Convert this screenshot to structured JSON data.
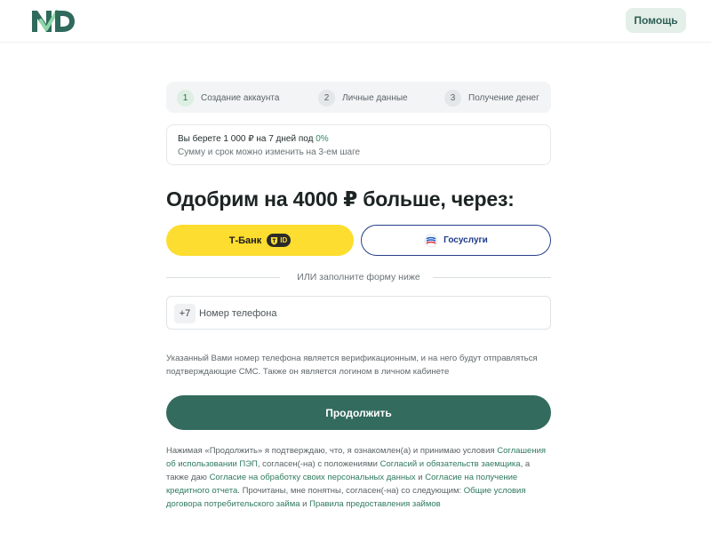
{
  "header": {
    "logo_text": "ND",
    "help_label": "Помощь",
    "brand_color": "#2f6a5c"
  },
  "steps": [
    {
      "num": "1",
      "label": "Создание аккаунта",
      "active": true
    },
    {
      "num": "2",
      "label": "Личные данные",
      "active": false
    },
    {
      "num": "3",
      "label": "Получение денег",
      "active": false
    }
  ],
  "loan_info": {
    "line1_prefix": "Вы берете 1 000 ₽ на 7 дней под ",
    "rate": "0%",
    "line2": "Сумму и срок можно изменить на 3-ем шаге"
  },
  "main": {
    "title": "Одобрим на 4000 ₽ больше, через:",
    "tbank_label": "Т-Банк",
    "tbank_badge": "ID",
    "gosuslugi_label": "Госуслуги",
    "or_text": "ИЛИ заполните форму ниже"
  },
  "phone": {
    "prefix": "+7",
    "placeholder": "Номер телефона",
    "value": "",
    "note": "Указанный Вами номер телефона является верификационным, и на него будут отправляться подтверждающие СМС. Также он является логином в личном кабинете"
  },
  "continue_label": "Продолжить",
  "consent": {
    "part1": "Нажимая «Продолжить» я подтверждаю, что, я ознакомлен(а) и принимаю условия ",
    "link1": "Соглашения об использовании ПЭП",
    "part2": ", согласен(-на) с положениями ",
    "link2": "Согласий и обязательств заемщика",
    "part3": ", а также даю ",
    "link3": "Согласие на обработку своих персональных данных",
    "part4": " и ",
    "link4": "Согласие на получение кредитного отчета",
    "part5": ". Прочитаны, мне понятны, согласен(-на) со следующим: ",
    "link5": "Общие условия договора потребительского займа",
    "part6": " и ",
    "link6": "Правила предоставления займов"
  },
  "colors": {
    "accent": "#336b5e",
    "tbank_yellow": "#fddd2f",
    "gosuslugi_blue": "#27408b"
  }
}
